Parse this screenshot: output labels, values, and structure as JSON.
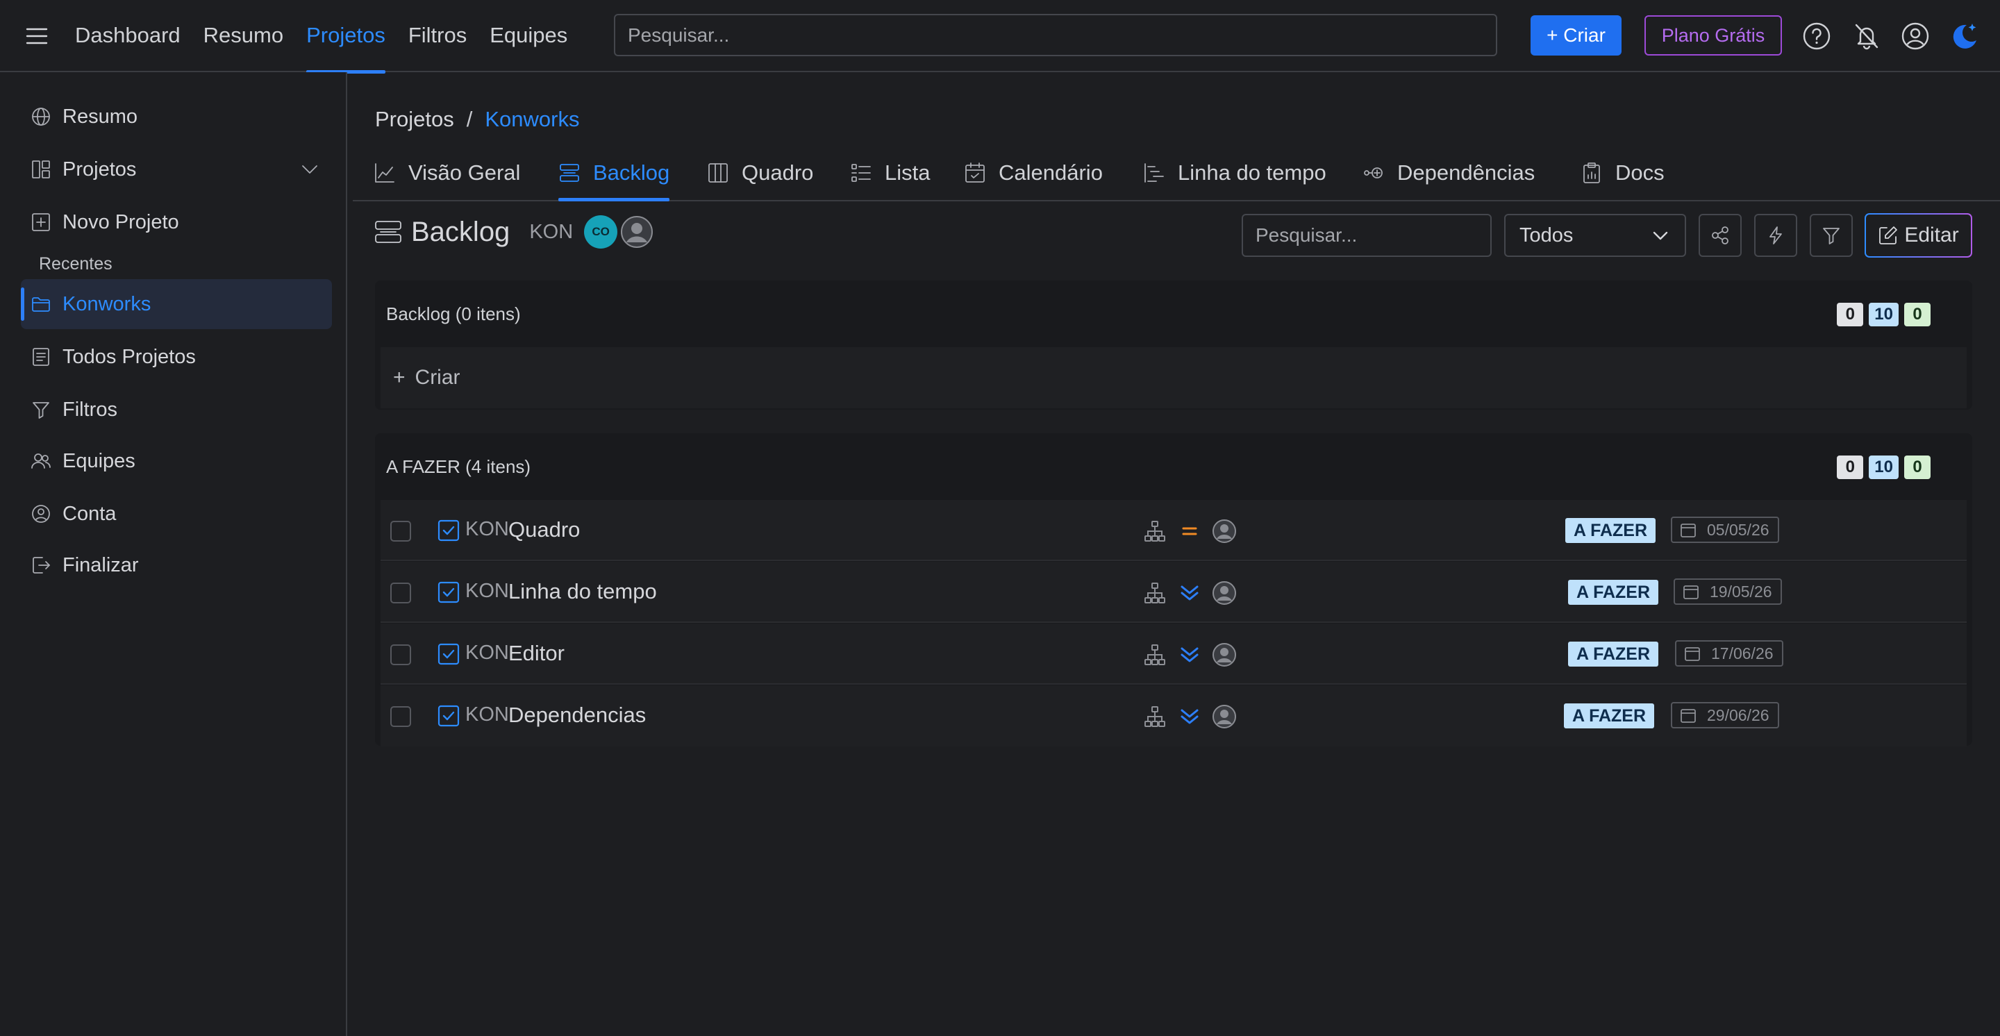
{
  "topbar": {
    "nav": [
      "Dashboard",
      "Resumo",
      "Projetos",
      "Filtros",
      "Equipes"
    ],
    "active_nav": "Projetos",
    "search_placeholder": "Pesquisar...",
    "create_label": "+ Criar",
    "plan_label": "Plano Grátis",
    "icons": [
      "help-icon",
      "bell-off-icon",
      "user-circle-icon",
      "dark-mode-icon"
    ]
  },
  "sidebar": {
    "items": [
      {
        "label": "Resumo",
        "icon": "globe-icon"
      },
      {
        "label": "Projetos",
        "icon": "layout-icon"
      },
      {
        "label": "Novo Projeto",
        "icon": "plus-square-icon"
      },
      {
        "label": "Konworks",
        "icon": "folder-icon"
      },
      {
        "label": "Todos Projetos",
        "icon": "list-box-icon"
      },
      {
        "label": "Filtros",
        "icon": "filter-icon"
      },
      {
        "label": "Equipes",
        "icon": "users-icon"
      },
      {
        "label": "Conta",
        "icon": "user-circle-icon"
      },
      {
        "label": "Finalizar",
        "icon": "logout-icon"
      }
    ],
    "section_label": "Recentes",
    "active_item": "Konworks"
  },
  "breadcrumb": {
    "root": "Projetos",
    "separator": "/",
    "current": "Konworks"
  },
  "tabs": [
    {
      "label": "Visão Geral",
      "icon": "chart-line-icon"
    },
    {
      "label": "Backlog",
      "icon": "backlog-icon"
    },
    {
      "label": "Quadro",
      "icon": "columns-icon"
    },
    {
      "label": "Lista",
      "icon": "list-icon"
    },
    {
      "label": "Calendário",
      "icon": "calendar-icon"
    },
    {
      "label": "Linha do tempo",
      "icon": "timeline-icon"
    },
    {
      "label": "Dependências",
      "icon": "dependency-icon"
    },
    {
      "label": "Docs",
      "icon": "clipboard-icon"
    }
  ],
  "active_tab": "Backlog",
  "page": {
    "title": "Backlog",
    "project_key": "KON",
    "avatar_initials": "CO",
    "search_placeholder": "Pesquisar...",
    "filter_value": "Todos",
    "edit_label": "Editar"
  },
  "backlog_section": {
    "title": "Backlog (0 itens)",
    "counts": [
      "0",
      "10",
      "0"
    ],
    "create_label": "Criar"
  },
  "todo_section": {
    "title": "A FAZER (4 itens)",
    "counts": [
      "0",
      "10",
      "0"
    ],
    "rows": [
      {
        "key": "KON",
        "name": "Quadro",
        "status": "A FAZER",
        "date": "05/05/26",
        "priority": "medium-priority-icon"
      },
      {
        "key": "KON",
        "name": "Linha do tempo",
        "status": "A FAZER",
        "date": "19/05/26",
        "priority": "lowest-priority-icon"
      },
      {
        "key": "KON",
        "name": "Editor",
        "status": "A FAZER",
        "date": "17/06/26",
        "priority": "lowest-priority-icon"
      },
      {
        "key": "KON",
        "name": "Dependencias",
        "status": "A FAZER",
        "date": "29/06/26",
        "priority": "lowest-priority-icon"
      }
    ]
  },
  "colors": {
    "accent": "#2d8cff",
    "primary_button": "#1f6ff0",
    "plan_purple": "#b56cf0",
    "status_bg": "#bfe1fb",
    "priority_medium": "#f08a24",
    "priority_low": "#2d7ff9"
  }
}
